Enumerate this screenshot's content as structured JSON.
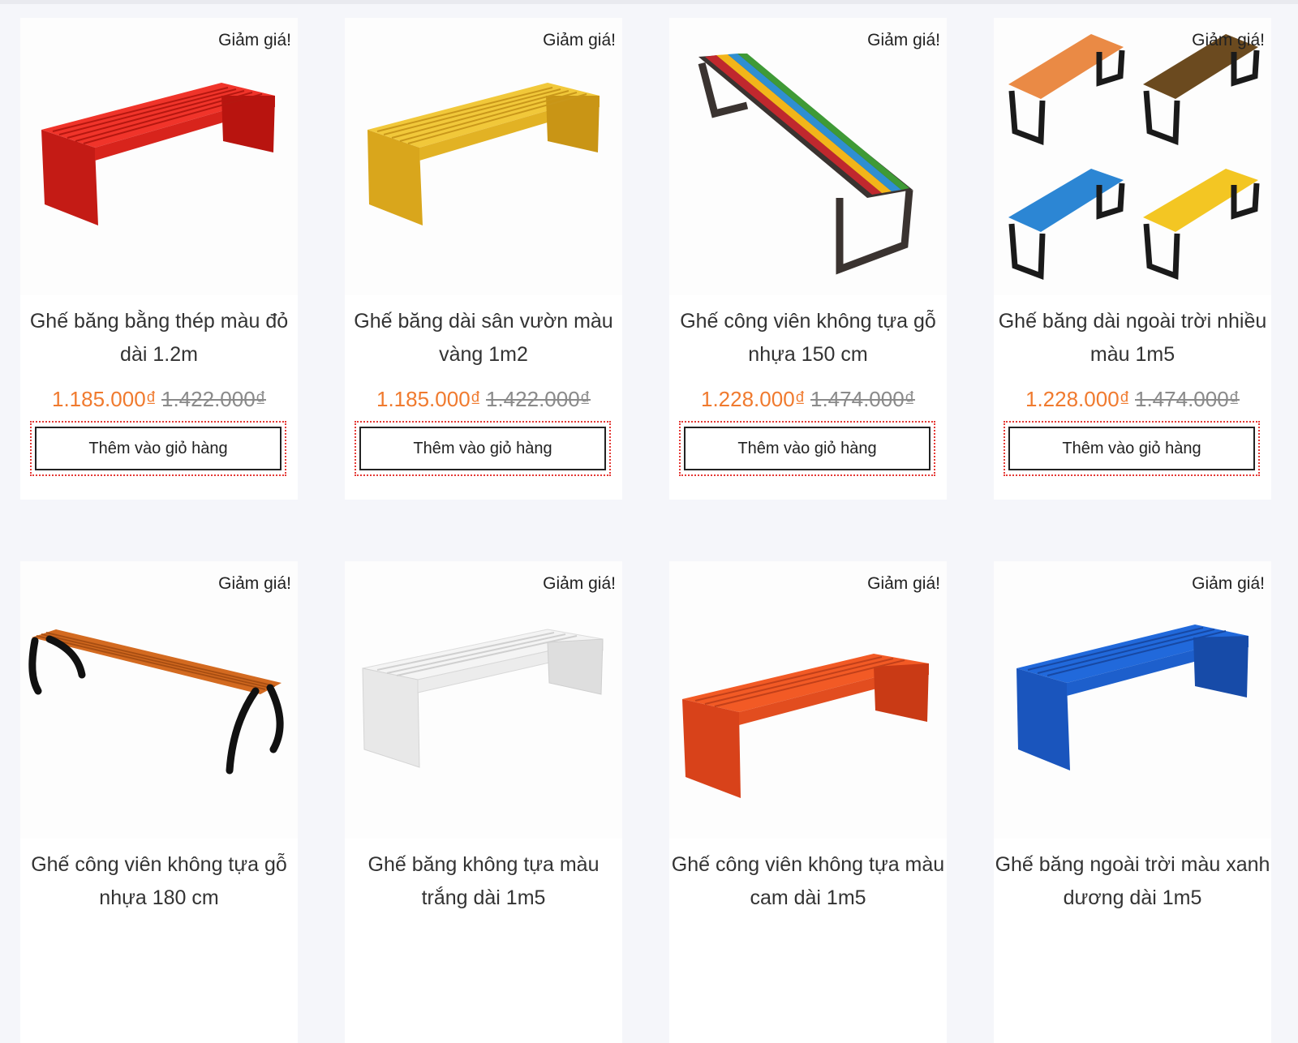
{
  "products": [
    {
      "badge": "Giảm giá!",
      "name": "Ghế băng bằng thép màu đỏ dài 1.2m",
      "price": "1.185.000₫",
      "old_price": "1.422.000₫",
      "button": "Thêm vào giỏ hàng",
      "color": "#e5231b",
      "image": "steel-bench-red"
    },
    {
      "badge": "Giảm giá!",
      "name": "Ghế băng dài sân vườn màu vàng 1m2",
      "price": "1.185.000₫",
      "old_price": "1.422.000₫",
      "button": "Thêm vào giỏ hàng",
      "color": "#e9be25",
      "image": "steel-bench-yellow"
    },
    {
      "badge": "Giảm giá!",
      "name": "Ghế công viên không tựa gỗ nhựa 150 cm",
      "price": "1.228.000₫",
      "old_price": "1.474.000₫",
      "button": "Thêm vào giỏ hàng",
      "color": "#3a3330",
      "image": "rainbow-bench"
    },
    {
      "badge": "Giảm giá!",
      "name": "Ghế băng dài ngoài trời nhiều màu 1m5",
      "price": "1.228.000₫",
      "old_price": "1.474.000₫",
      "button": "Thêm vào giỏ hàng",
      "color": "#e9823c",
      "image": "multi-color-benches"
    },
    {
      "badge": "Giảm giá!",
      "name": "Ghế công viên không tựa gỗ nhựa 180 cm",
      "price": "",
      "old_price": "",
      "button": "",
      "color": "#d46a1e",
      "image": "wood-bench-cast-legs"
    },
    {
      "badge": "Giảm giá!",
      "name": "Ghế băng không tựa màu trắng dài 1m5",
      "price": "",
      "old_price": "",
      "button": "",
      "color": "#f3f3f3",
      "image": "steel-bench-white"
    },
    {
      "badge": "Giảm giá!",
      "name": "Ghế công viên không tựa màu cam dài 1m5",
      "price": "",
      "old_price": "",
      "button": "",
      "color": "#ef4a1a",
      "image": "steel-bench-orange"
    },
    {
      "badge": "Giảm giá!",
      "name": "Ghế băng ngoài trời màu xanh dương dài 1m5",
      "price": "",
      "old_price": "",
      "button": "",
      "color": "#1e5fd6",
      "image": "steel-bench-blue"
    }
  ]
}
